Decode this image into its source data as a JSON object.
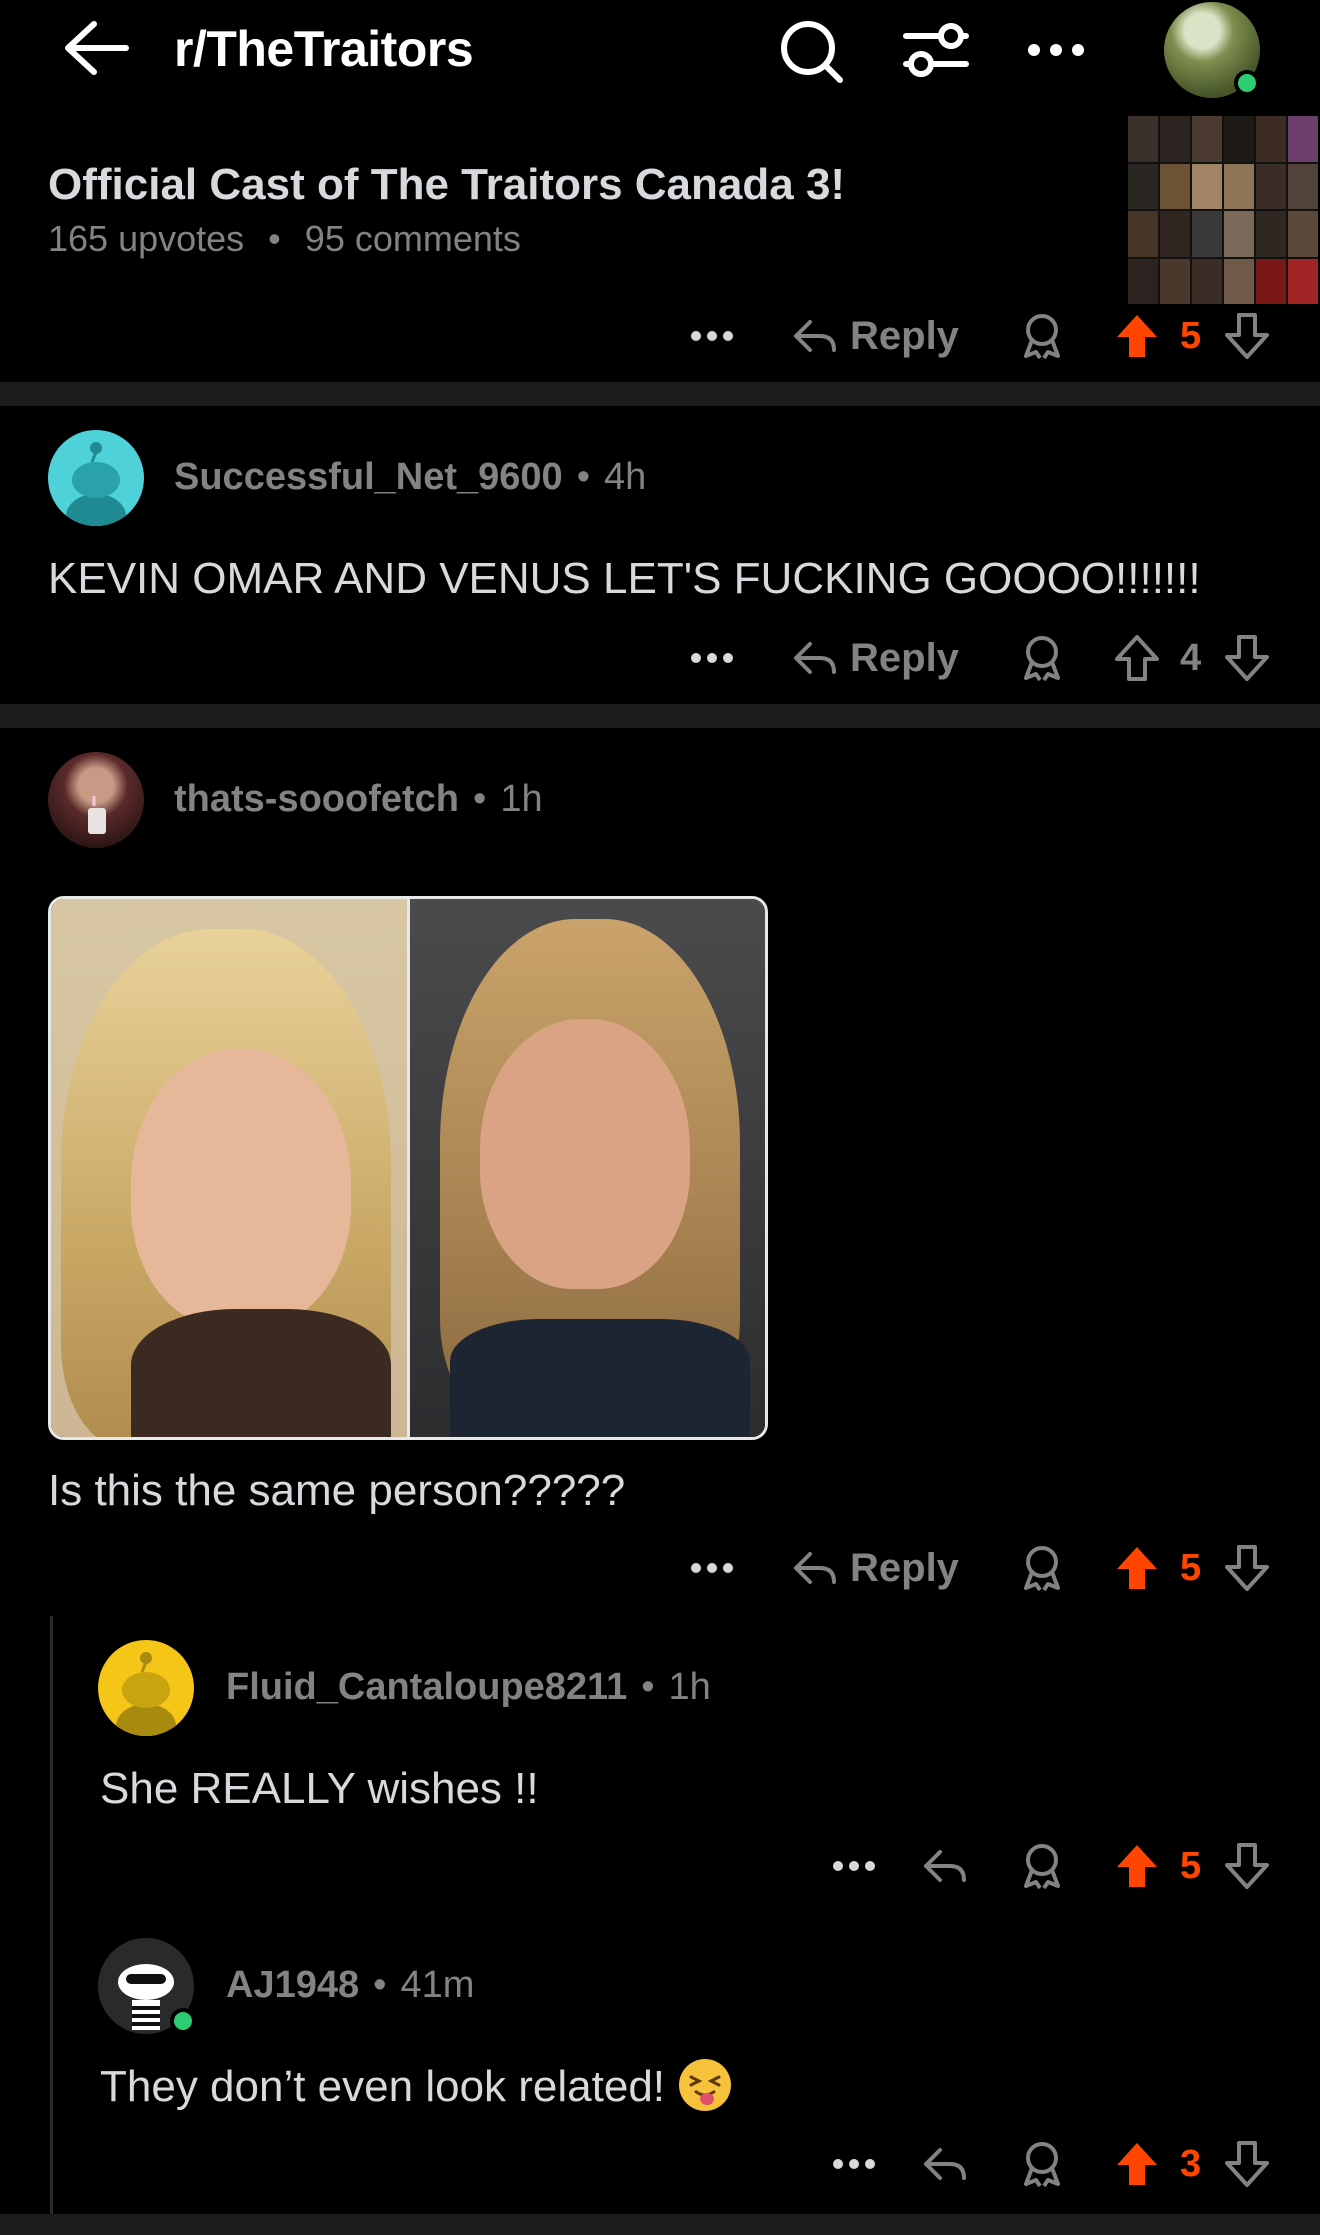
{
  "header": {
    "subreddit": "r/TheTraitors",
    "icons": [
      "back-arrow-icon",
      "search-icon",
      "filter-icon",
      "more-icon",
      "user-avatar"
    ]
  },
  "post": {
    "title": "Official Cast of The Traitors Canada 3!",
    "upvotes": "165 upvotes",
    "comments": "95 comments",
    "separator": "•",
    "reply": "Reply",
    "score": "5",
    "vote_state": "upvoted"
  },
  "colors": {
    "accent": "#ff4500",
    "muted": "#818384",
    "text": "#d7dadc",
    "online": "#2ecc71"
  },
  "comments": [
    {
      "user": "Successful_Net_9600",
      "dot": "•",
      "time": "4h",
      "body": "KEVIN OMAR AND VENUS LET'S FUCKING GOOOO!!!!!!!",
      "reply": "Reply",
      "score": "4",
      "vote_state": "none"
    },
    {
      "user": "thats-sooofetch",
      "dot": "•",
      "time": "1h",
      "body": "Is this the same person?????",
      "reply": "Reply",
      "score": "5",
      "vote_state": "upvoted",
      "has_image": true
    },
    {
      "user": "Fluid_Cantaloupe8211",
      "dot": "•",
      "time": "1h",
      "body": "She REALLY wishes !!",
      "score": "5",
      "vote_state": "upvoted"
    },
    {
      "user": "AJ1948",
      "dot": "•",
      "time": "41m",
      "body": "They don’t even look related!",
      "emoji": "squinting-face-with-tongue",
      "score": "3",
      "vote_state": "upvoted"
    }
  ]
}
